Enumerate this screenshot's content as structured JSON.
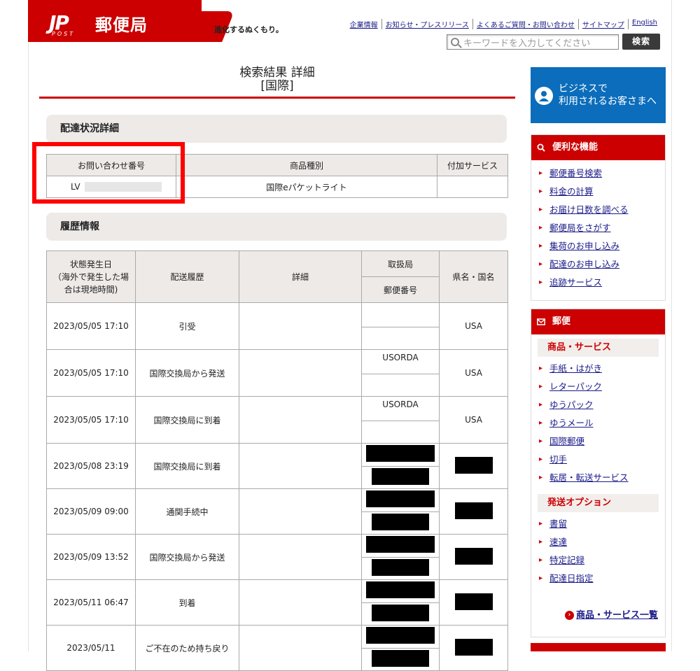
{
  "header": {
    "logo_mark": "JP",
    "logo_post": "POST",
    "logo_name": "郵便局",
    "tagline": "進化するぬくもり。",
    "links": [
      "企業情報",
      "お知らせ・プレスリリース",
      "よくあるご質問・お問い合わせ",
      "サイトマップ",
      "English"
    ],
    "search_placeholder": "キーワードを入力してください",
    "search_button": "検索"
  },
  "page": {
    "title_line1": "検索結果 詳細",
    "title_line2": "[国際]"
  },
  "delivery_status": {
    "heading": "配達状況詳細",
    "columns": [
      "お問い合わせ番号",
      "商品種別",
      "付加サービス"
    ],
    "tracking_prefix": "LV",
    "product_type": "国際eパケットライト",
    "extra_service": ""
  },
  "history": {
    "heading": "履歴情報",
    "columns": {
      "date": "状態発生日\n（海外で発生した場合は現地時間)",
      "event": "配送履歴",
      "detail": "詳細",
      "office": "取扱局",
      "postal": "郵便番号",
      "region": "県名・国名"
    },
    "rows": [
      {
        "date": "2023/05/05 17:10",
        "event": "引受",
        "detail": "",
        "office": "",
        "postal": "",
        "region": "USA",
        "masked": false
      },
      {
        "date": "2023/05/05 17:10",
        "event": "国際交換局から発送",
        "detail": "",
        "office": "USORDA",
        "postal": "",
        "region": "USA",
        "masked": false
      },
      {
        "date": "2023/05/05 17:10",
        "event": "国際交換局に到着",
        "detail": "",
        "office": "USORDA",
        "postal": "",
        "region": "USA",
        "masked": false
      },
      {
        "date": "2023/05/08 23:19",
        "event": "国際交換局に到着",
        "detail": "",
        "office": "",
        "postal": "",
        "region": "",
        "masked": true
      },
      {
        "date": "2023/05/09 09:00",
        "event": "通関手続中",
        "detail": "",
        "office": "",
        "postal": "",
        "region": "",
        "masked": true
      },
      {
        "date": "2023/05/09 13:52",
        "event": "国際交換局から発送",
        "detail": "",
        "office": "",
        "postal": "",
        "region": "",
        "masked": true
      },
      {
        "date": "2023/05/11 06:47",
        "event": "到着",
        "detail": "",
        "office": "",
        "postal": "",
        "region": "",
        "masked": true
      },
      {
        "date": "2023/05/11",
        "event": "ご不在のため持ち戻り",
        "detail": "",
        "office": "",
        "postal": "",
        "region": "",
        "masked": true
      }
    ]
  },
  "sidebar": {
    "business_banner": "ビジネスで\n利用されるお客さまへ",
    "features": {
      "title": "便利な機能",
      "items": [
        "郵便番号検索",
        "料金の計算",
        "お届け日数を調べる",
        "郵便局をさがす",
        "集荷のお申し込み",
        "配達のお申し込み",
        "追跡サービス"
      ]
    },
    "mail": {
      "title": "郵便",
      "products_heading": "商品・サービス",
      "products": [
        "手紙・はがき",
        "レターパック",
        "ゆうパック",
        "ゆうメール",
        "国際郵便",
        "切手",
        "転居・転送サービス"
      ],
      "options_heading": "発送オプション",
      "options": [
        "書留",
        "速達",
        "特定記録",
        "配達日指定"
      ],
      "more_link": "商品・サービス一覧"
    }
  },
  "colors": {
    "brand_red": "#cc0000",
    "business_blue": "#0b6dbb",
    "link": "#1a1a88",
    "header_gray": "#eeeae8"
  }
}
